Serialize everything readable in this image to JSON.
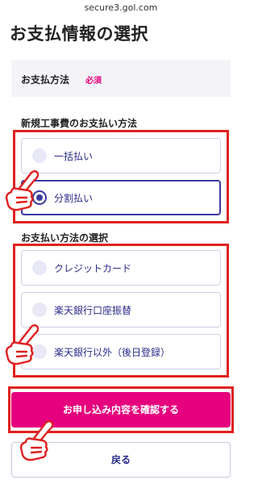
{
  "browser": {
    "url": "secure3.gol.com"
  },
  "page": {
    "title": "お支払情報の選択"
  },
  "payment_method": {
    "label": "お支払方法",
    "required_badge": "必須"
  },
  "construction_fee": {
    "heading": "新規工事費のお支払い方法",
    "options": [
      {
        "label": "一括払い",
        "selected": false
      },
      {
        "label": "分割払い",
        "selected": true
      }
    ]
  },
  "payment_selection": {
    "heading": "お支払い方法の選択",
    "options": [
      {
        "label": "クレジットカード",
        "selected": false
      },
      {
        "label": "楽天銀行口座振替",
        "selected": false
      },
      {
        "label": "楽天銀行以外（後日登録）",
        "selected": false
      }
    ]
  },
  "actions": {
    "confirm_label": "お申し込み内容を確認する",
    "back_label": "戻る"
  },
  "colors": {
    "accent": "#e6007e",
    "highlight_frame": "#e02020",
    "selected_radio": "#3a3aa0"
  },
  "icons": [
    "pointing-hand-icon"
  ]
}
